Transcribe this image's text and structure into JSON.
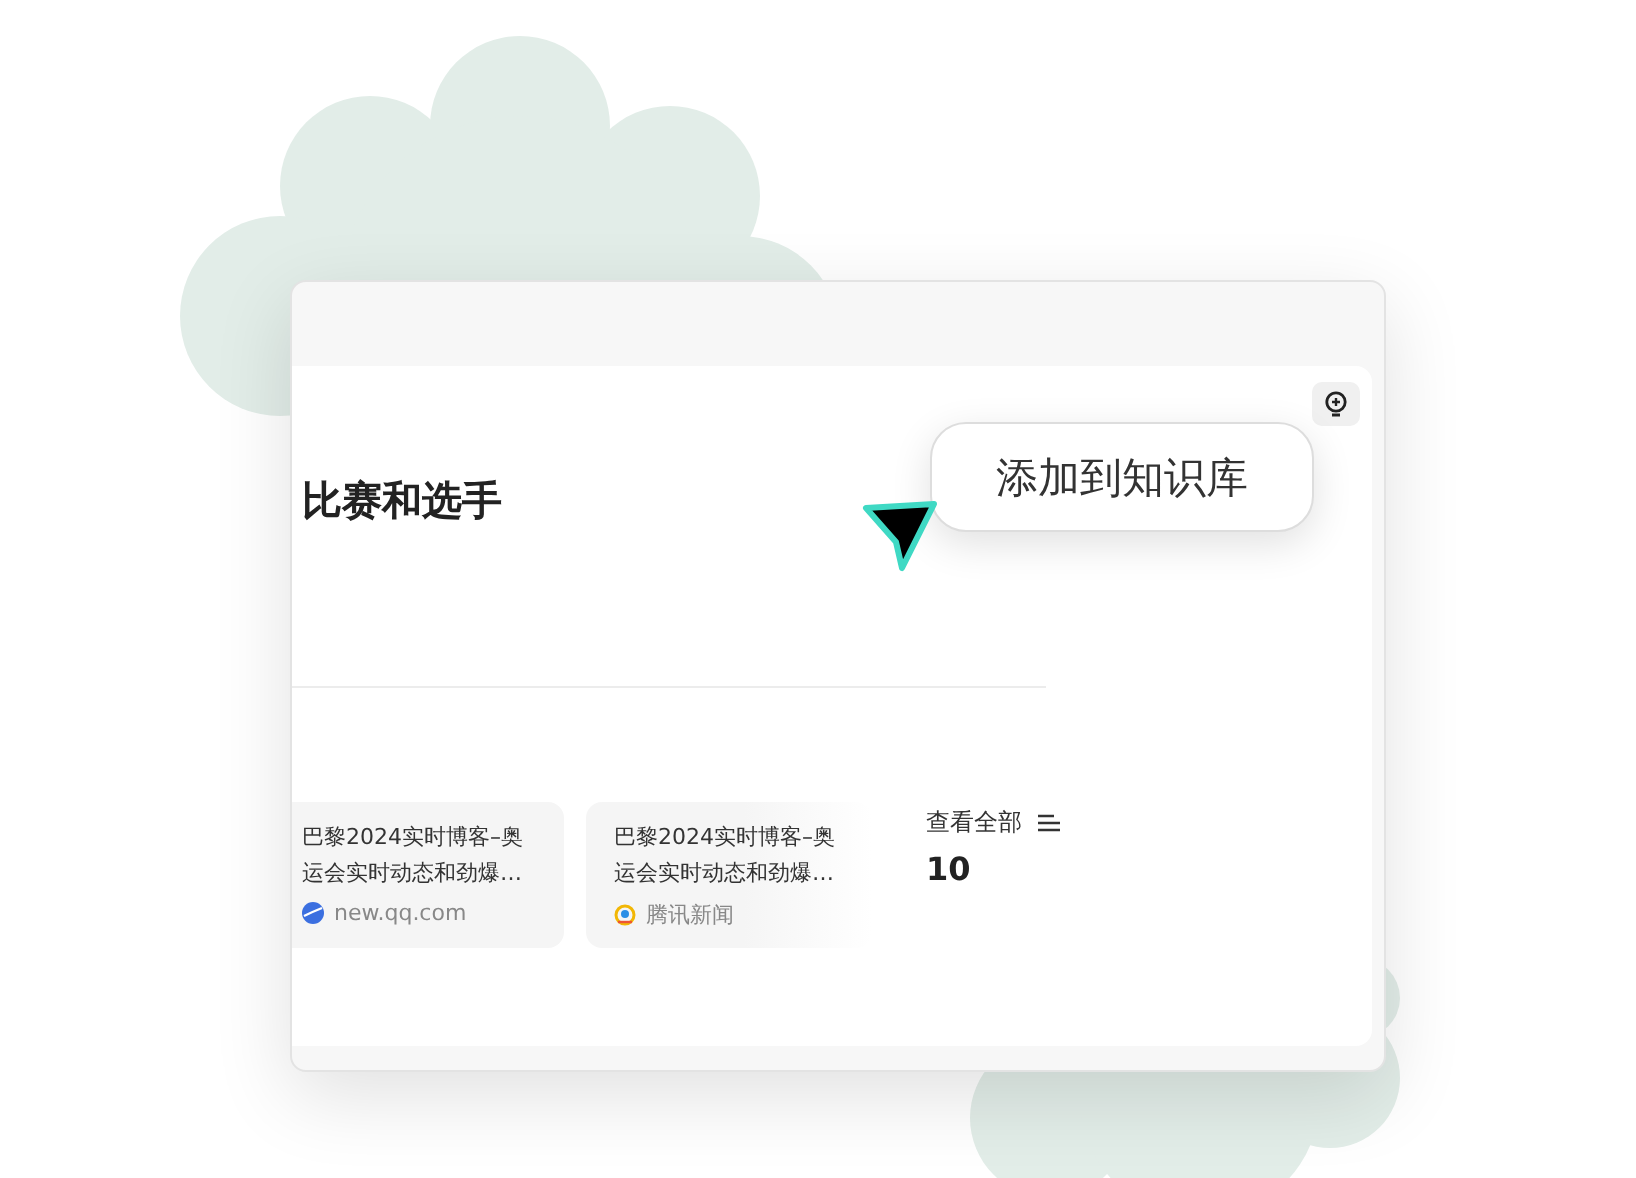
{
  "heading": "比赛和选手",
  "tooltip": {
    "label": "添加到知识库"
  },
  "sources": [
    {
      "title": "巴黎2024实时博客–奥运会实时动态和劲爆…",
      "source": "new.qq.com",
      "kind": "web"
    },
    {
      "title": "巴黎2024实时博客–奥运会实时动态和劲爆…",
      "source": "腾讯新闻",
      "kind": "news"
    }
  ],
  "view_all": {
    "label": "查看全部",
    "count": "10"
  }
}
